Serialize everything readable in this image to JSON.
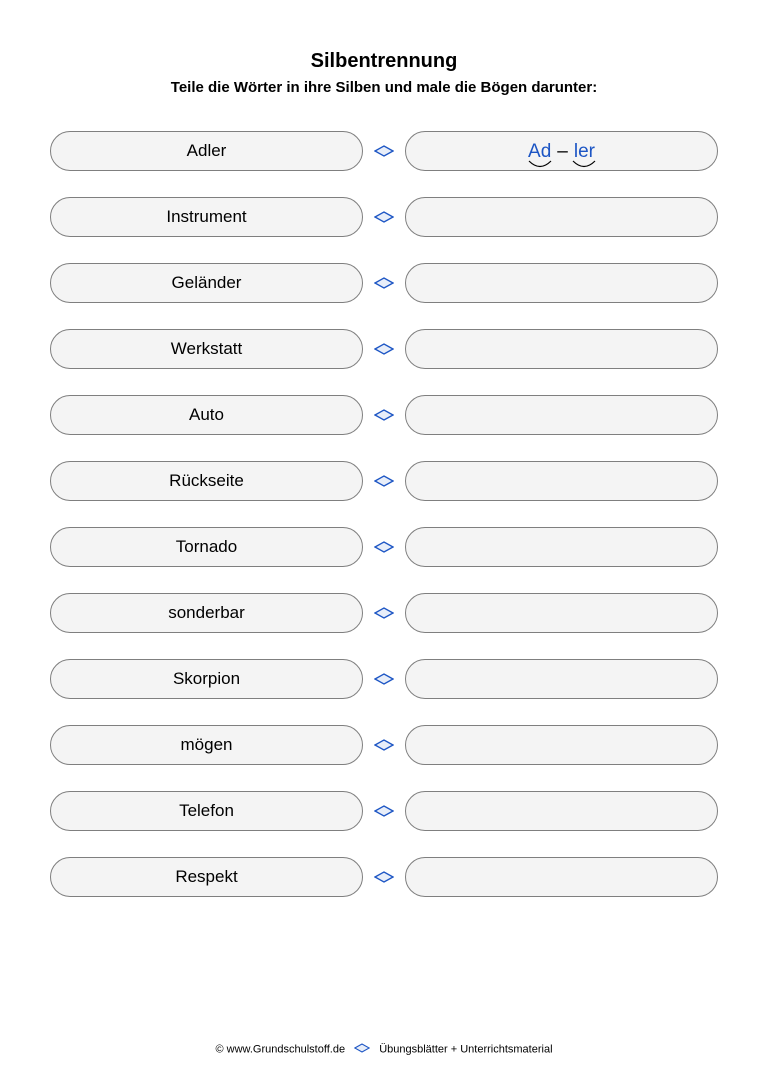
{
  "title": "Silbentrennung",
  "subtitle": "Teile die Wörter in ihre Silben und male die Bögen darunter:",
  "words": [
    "Adler",
    "Instrument",
    "Geländer",
    "Werkstatt",
    "Auto",
    "Rückseite",
    "Tornado",
    "sonderbar",
    "Skorpion",
    "mögen",
    "Telefon",
    "Respekt"
  ],
  "example": {
    "syllables": [
      "Ad",
      "ler"
    ],
    "separator": "–"
  },
  "footer": {
    "copyright": "© www.Grundschulstoff.de",
    "text": "Übungsblätter + Unterrichtsmaterial"
  }
}
